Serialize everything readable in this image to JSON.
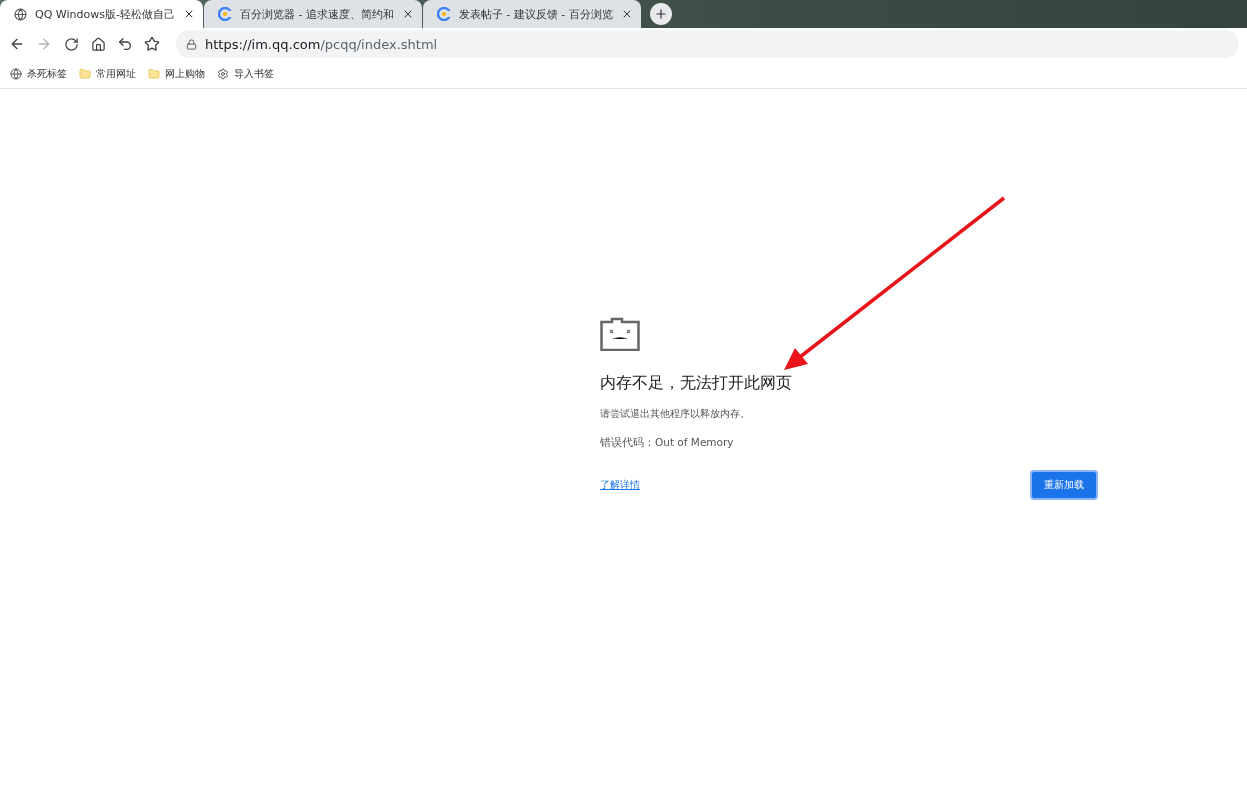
{
  "tabs": [
    {
      "kind": "globe",
      "title": "QQ Windows版-轻松做自己",
      "selected": true
    },
    {
      "kind": "browser",
      "title": "百分浏览器 - 追求速度、简约和",
      "selected": false
    },
    {
      "kind": "browser",
      "title": "发表帖子 - 建议反馈 - 百分浏览",
      "selected": false
    }
  ],
  "toolbar": {
    "forward_disabled": true,
    "address": {
      "host": "https://im.qq.com",
      "path": "/pcqq/index.shtml"
    }
  },
  "bookmarks": [
    {
      "kind": "globe",
      "label": "杀死标签"
    },
    {
      "kind": "folder",
      "label": "常用网址"
    },
    {
      "kind": "folder",
      "label": "网上购物"
    },
    {
      "kind": "gear",
      "label": "导入书签"
    }
  ],
  "error": {
    "title": "内存不足，无法打开此网页",
    "message": "请尝试退出其他程序以释放内存。",
    "code": "错误代码：Out of Memory",
    "link": "了解详情",
    "button": "重新加载"
  }
}
